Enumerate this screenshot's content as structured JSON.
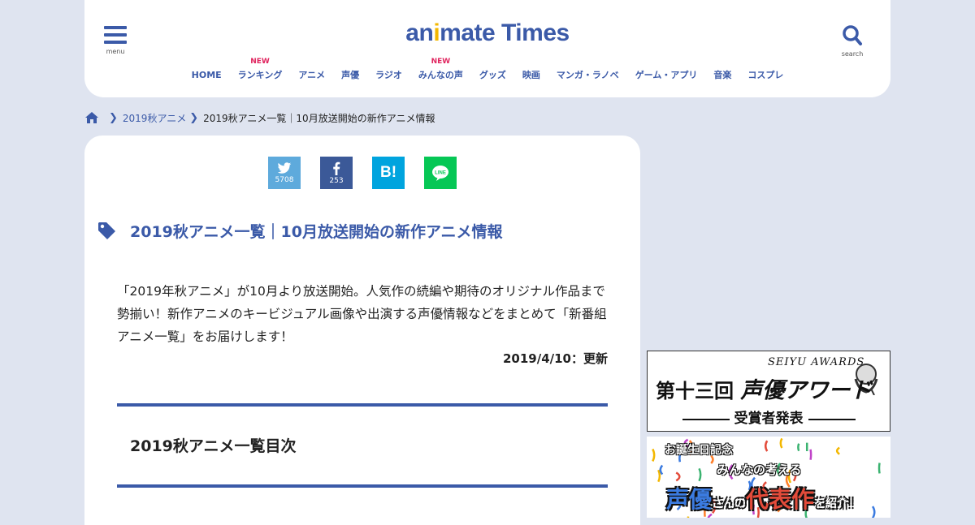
{
  "header": {
    "logo_prefix": "an",
    "logo_i": "i",
    "logo_suffix": "mate Times",
    "menu_label": "menu",
    "search_label": "search",
    "nav": [
      {
        "label": "HOME",
        "badge": ""
      },
      {
        "label": "ランキング",
        "badge": "NEW"
      },
      {
        "label": "アニメ",
        "badge": ""
      },
      {
        "label": "声優",
        "badge": ""
      },
      {
        "label": "ラジオ",
        "badge": ""
      },
      {
        "label": "みんなの声",
        "badge": "NEW"
      },
      {
        "label": "グッズ",
        "badge": ""
      },
      {
        "label": "映画",
        "badge": ""
      },
      {
        "label": "マンガ・ラノベ",
        "badge": ""
      },
      {
        "label": "ゲーム・アプリ",
        "badge": ""
      },
      {
        "label": "音楽",
        "badge": ""
      },
      {
        "label": "コスプレ",
        "badge": ""
      }
    ],
    "colors": {
      "brand": "#3b5aa8",
      "logo_dot": "#f3b700",
      "new_badge": "#e0245e"
    }
  },
  "breadcrumb": {
    "home_icon": "home-icon",
    "category": "2019秋アニメ",
    "current": "2019秋アニメ一覧｜10月放送開始の新作アニメ情報"
  },
  "share": {
    "twitter_count": "5708",
    "facebook_count": "253",
    "hatena_label": "B!",
    "line_icon": "line-icon"
  },
  "article": {
    "title": "2019秋アニメ一覧｜10月放送開始の新作アニメ情報",
    "description": "「2019年秋アニメ」が10月より放送開始。人気作の続編や期待のオリジナル作品まで勢揃い！新作アニメのキービジュアル画像や出演する声優情報などをまとめて「新番組アニメ一覧」をお届けします！",
    "updated": "2019/4/10：更新",
    "toc_title": "2019秋アニメ一覧目次"
  },
  "sidebar": {
    "banner1": {
      "en": "SEIYU AWARDS",
      "jp_prefix": "第十三回",
      "jp_main": "声優アワード",
      "sub": "受賞者発表"
    },
    "banner2": {
      "line1": "お誕生日記念",
      "line2": "みんなの考える",
      "seiyu": "声優",
      "san_no": "さんの",
      "daihyo": "代表作",
      "tail": "を紹介！"
    }
  }
}
